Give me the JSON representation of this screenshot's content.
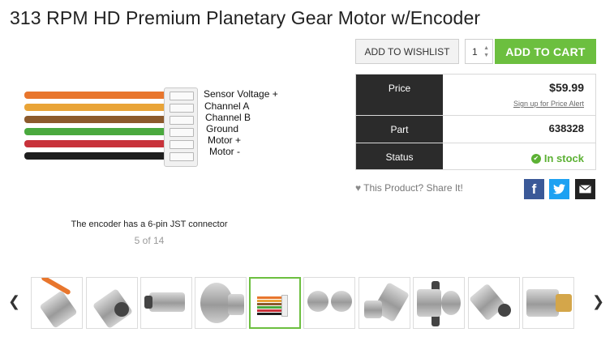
{
  "product": {
    "title": "313 RPM HD Premium Planetary Gear Motor w/Encoder"
  },
  "gallery": {
    "wire_labels": [
      "Sensor Voltage +",
      "Channel A",
      "Channel B",
      "Ground",
      "Motor +",
      "Motor -"
    ],
    "wire_colors": [
      "#e8762d",
      "#e9a437",
      "#8c5a2c",
      "#4aa93e",
      "#c8323a",
      "#1e1e1e"
    ],
    "caption": "The encoder has a 6-pin JST connector",
    "counter": "5 of 14",
    "active_thumbnail": 5,
    "thumbnail_count": 10,
    "prev_icon": "chevron-left-icon",
    "next_icon": "chevron-right-icon"
  },
  "actions": {
    "wishlist_label": "ADD TO WISHLIST",
    "quantity": "1",
    "add_to_cart_label": "ADD TO CART",
    "add_to_cart_color": "#6cbf3f"
  },
  "info": {
    "price_label": "Price",
    "price": "$59.99",
    "price_alert": "Sign up for Price Alert",
    "part_label": "Part",
    "part": "638328",
    "status_label": "Status",
    "status": "In stock",
    "status_color": "#5cb134"
  },
  "share": {
    "text": "This Product? Share It!",
    "icons": [
      "facebook-icon",
      "twitter-icon",
      "email-icon"
    ]
  }
}
